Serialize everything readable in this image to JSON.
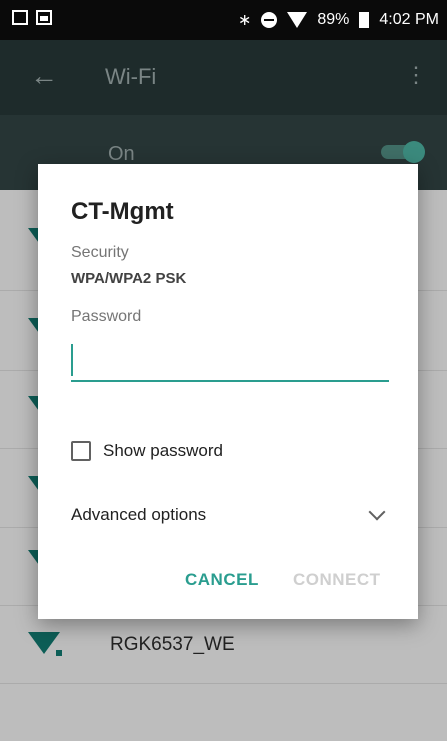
{
  "status_bar": {
    "battery_percent": "89%",
    "time": "4:02 PM",
    "icons": [
      "notification-icon",
      "image-icon",
      "bluetooth-icon",
      "do-not-disturb-icon",
      "wifi-signal-icon",
      "battery-icon"
    ]
  },
  "app_bar": {
    "title": "Wi-Fi",
    "back_icon": "arrow-back-icon",
    "more_icon": "more-vert-icon"
  },
  "master_switch": {
    "label": "On",
    "state": "on"
  },
  "networks_visible": [
    {
      "name": "RGK6537_WE",
      "secured": true
    }
  ],
  "dialog": {
    "title": "CT-Mgmt",
    "security_label": "Security",
    "security_value": "WPA/WPA2 PSK",
    "password_label": "Password",
    "password_value": "",
    "show_password_label": "Show password",
    "show_password_checked": false,
    "advanced_label": "Advanced options",
    "cancel_label": "CANCEL",
    "connect_label": "CONNECT",
    "connect_enabled": false
  },
  "colors": {
    "accent": "#2a9d8f",
    "disabled": "#cfcfcf"
  }
}
